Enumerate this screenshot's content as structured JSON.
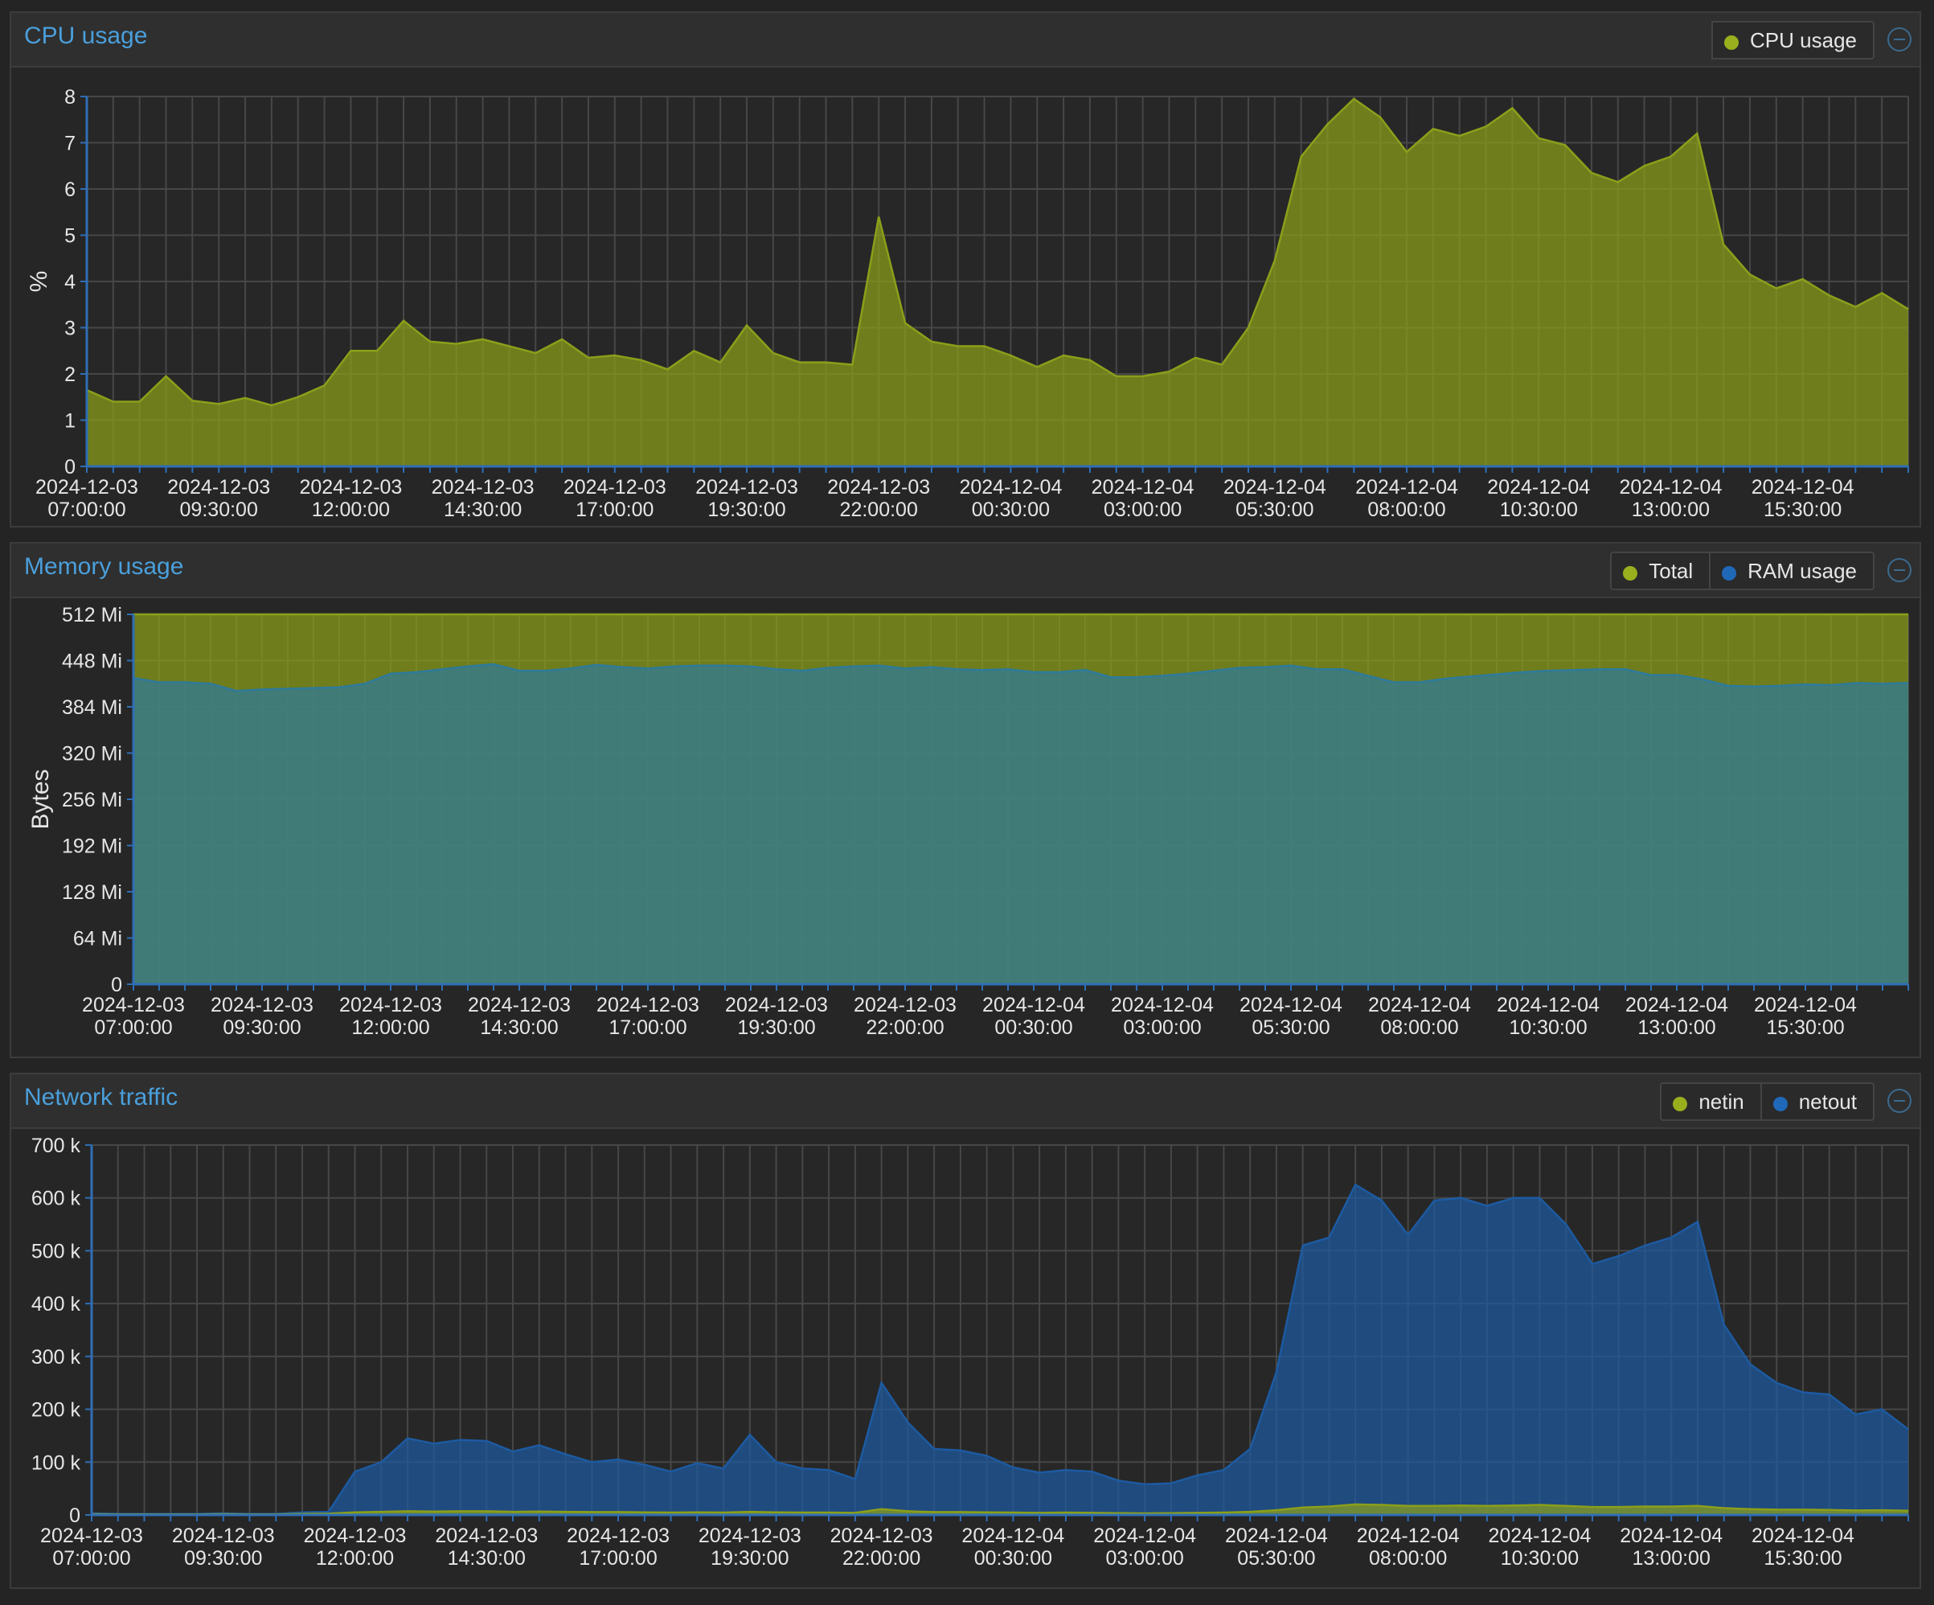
{
  "colors": {
    "green": "#8c9f1a",
    "blue": "#1d5aa1",
    "grid": "#474747",
    "axis": "#2f6eb5"
  },
  "panels": [
    {
      "title": "CPU usage",
      "legend": [
        {
          "label": "CPU usage",
          "color": "#9aaf1e"
        }
      ]
    },
    {
      "title": "Memory usage",
      "legend": [
        {
          "label": "Total",
          "color": "#9aaf1e"
        },
        {
          "label": "RAM usage",
          "color": "#2068b8"
        }
      ]
    },
    {
      "title": "Network traffic",
      "legend": [
        {
          "label": "netin",
          "color": "#9aaf1e"
        },
        {
          "label": "netout",
          "color": "#2068b8"
        }
      ]
    }
  ],
  "chart_data": [
    {
      "type": "area",
      "title": "CPU usage",
      "ylabel": "%",
      "xlabel": "",
      "ylim": [
        0,
        8
      ],
      "yticks": [
        "0",
        "1",
        "2",
        "3",
        "4",
        "5",
        "6",
        "7",
        "8"
      ],
      "x_tick_labels": [
        [
          "2024-12-03",
          "07:00:00"
        ],
        [
          "2024-12-03",
          "09:30:00"
        ],
        [
          "2024-12-03",
          "12:00:00"
        ],
        [
          "2024-12-03",
          "14:30:00"
        ],
        [
          "2024-12-03",
          "17:00:00"
        ],
        [
          "2024-12-03",
          "19:30:00"
        ],
        [
          "2024-12-03",
          "22:00:00"
        ],
        [
          "2024-12-04",
          "00:30:00"
        ],
        [
          "2024-12-04",
          "03:00:00"
        ],
        [
          "2024-12-04",
          "05:30:00"
        ],
        [
          "2024-12-04",
          "08:00:00"
        ],
        [
          "2024-12-04",
          "10:30:00"
        ],
        [
          "2024-12-04",
          "13:00:00"
        ],
        [
          "2024-12-04",
          "15:30:00"
        ]
      ],
      "x_start": "2024-12-03 07:00:00",
      "x_interval_minutes": 30,
      "grid": true,
      "legend": "top-right",
      "series": [
        {
          "name": "CPU usage",
          "color": "#8c9f1a",
          "values": [
            1.65,
            1.4,
            1.4,
            1.95,
            1.42,
            1.35,
            1.48,
            1.32,
            1.5,
            1.75,
            2.5,
            2.5,
            3.15,
            2.7,
            2.65,
            2.75,
            2.6,
            2.45,
            2.75,
            2.35,
            2.4,
            2.3,
            2.1,
            2.5,
            2.25,
            3.05,
            2.45,
            2.25,
            2.25,
            2.2,
            5.4,
            3.1,
            2.7,
            2.6,
            2.6,
            2.4,
            2.15,
            2.4,
            2.3,
            1.95,
            1.95,
            2.05,
            2.35,
            2.2,
            3.0,
            4.45,
            6.7,
            7.4,
            7.95,
            7.55,
            6.8,
            7.3,
            7.15,
            7.35,
            7.75,
            7.1,
            6.95,
            6.35,
            6.15,
            6.5,
            6.7,
            7.2,
            4.8,
            4.15,
            3.85,
            4.05,
            3.7,
            3.45,
            3.75,
            3.4
          ]
        }
      ]
    },
    {
      "type": "area",
      "title": "Memory usage",
      "ylabel": "Bytes",
      "xlabel": "",
      "ylim": [
        0,
        512
      ],
      "yticks": [
        "0",
        "64 Mi",
        "128 Mi",
        "192 Mi",
        "256 Mi",
        "320 Mi",
        "384 Mi",
        "448 Mi",
        "512 Mi"
      ],
      "x_tick_labels": [
        [
          "2024-12-03",
          "07:00:00"
        ],
        [
          "2024-12-03",
          "09:30:00"
        ],
        [
          "2024-12-03",
          "12:00:00"
        ],
        [
          "2024-12-03",
          "14:30:00"
        ],
        [
          "2024-12-03",
          "17:00:00"
        ],
        [
          "2024-12-03",
          "19:30:00"
        ],
        [
          "2024-12-03",
          "22:00:00"
        ],
        [
          "2024-12-04",
          "00:30:00"
        ],
        [
          "2024-12-04",
          "03:00:00"
        ],
        [
          "2024-12-04",
          "05:30:00"
        ],
        [
          "2024-12-04",
          "08:00:00"
        ],
        [
          "2024-12-04",
          "10:30:00"
        ],
        [
          "2024-12-04",
          "13:00:00"
        ],
        [
          "2024-12-04",
          "15:30:00"
        ]
      ],
      "x_start": "2024-12-03 07:00:00",
      "x_interval_minutes": 30,
      "grid": true,
      "legend": "top-right",
      "series": [
        {
          "name": "Total",
          "color": "#8c9f1a",
          "values": [
            512,
            512,
            512,
            512,
            512,
            512,
            512,
            512,
            512,
            512,
            512,
            512,
            512,
            512,
            512,
            512,
            512,
            512,
            512,
            512,
            512,
            512,
            512,
            512,
            512,
            512,
            512,
            512,
            512,
            512,
            512,
            512,
            512,
            512,
            512,
            512,
            512,
            512,
            512,
            512,
            512,
            512,
            512,
            512,
            512,
            512,
            512,
            512,
            512,
            512,
            512,
            512,
            512,
            512,
            512,
            512,
            512,
            512,
            512,
            512,
            512,
            512,
            512,
            512,
            512,
            512,
            512,
            512,
            512,
            512
          ]
        },
        {
          "name": "RAM usage",
          "color": "#2e7a9a",
          "values": [
            424,
            418,
            418,
            416,
            406,
            408,
            409,
            410,
            411,
            416,
            430,
            432,
            436,
            440,
            443,
            434,
            434,
            437,
            442,
            439,
            437,
            440,
            441,
            441,
            440,
            436,
            434,
            438,
            440,
            441,
            437,
            439,
            436,
            435,
            436,
            432,
            432,
            435,
            425,
            425,
            427,
            430,
            434,
            438,
            439,
            441,
            436,
            436,
            427,
            418,
            418,
            423,
            426,
            429,
            432,
            434,
            435,
            436,
            436,
            428,
            428,
            422,
            413,
            412,
            413,
            415,
            414,
            417,
            416,
            417
          ]
        }
      ]
    },
    {
      "type": "area",
      "title": "Network traffic",
      "ylabel": "",
      "xlabel": "",
      "ylim": [
        0,
        700000
      ],
      "yticks": [
        "0",
        "100 k",
        "200 k",
        "300 k",
        "400 k",
        "500 k",
        "600 k",
        "700 k"
      ],
      "x_tick_labels": [
        [
          "2024-12-03",
          "07:00:00"
        ],
        [
          "2024-12-03",
          "09:30:00"
        ],
        [
          "2024-12-03",
          "12:00:00"
        ],
        [
          "2024-12-03",
          "14:30:00"
        ],
        [
          "2024-12-03",
          "17:00:00"
        ],
        [
          "2024-12-03",
          "19:30:00"
        ],
        [
          "2024-12-03",
          "22:00:00"
        ],
        [
          "2024-12-04",
          "00:30:00"
        ],
        [
          "2024-12-04",
          "03:00:00"
        ],
        [
          "2024-12-04",
          "05:30:00"
        ],
        [
          "2024-12-04",
          "08:00:00"
        ],
        [
          "2024-12-04",
          "10:30:00"
        ],
        [
          "2024-12-04",
          "13:00:00"
        ],
        [
          "2024-12-04",
          "15:30:00"
        ]
      ],
      "x_start": "2024-12-03 07:00:00",
      "x_interval_minutes": 30,
      "grid": true,
      "legend": "top-right",
      "series": [
        {
          "name": "netout",
          "color": "#1d5aa1",
          "values": [
            3000,
            2000,
            2000,
            2000,
            2000,
            3000,
            2000,
            2000,
            5000,
            6000,
            82000,
            100000,
            145000,
            135000,
            142000,
            140000,
            120000,
            132000,
            115000,
            100000,
            105000,
            95000,
            82000,
            98000,
            88000,
            152000,
            100000,
            88000,
            85000,
            68000,
            250000,
            175000,
            125000,
            122000,
            112000,
            90000,
            80000,
            85000,
            82000,
            65000,
            58000,
            60000,
            75000,
            85000,
            125000,
            270000,
            510000,
            525000,
            625000,
            595000,
            530000,
            595000,
            600000,
            585000,
            600000,
            600000,
            550000,
            475000,
            490000,
            510000,
            525000,
            555000,
            360000,
            285000,
            250000,
            232000,
            228000,
            190000,
            200000,
            162000
          ]
        },
        {
          "name": "netin",
          "color": "#8c9f1a",
          "values": [
            1500,
            1000,
            1000,
            1000,
            1000,
            1500,
            1000,
            1000,
            2000,
            2500,
            5000,
            6000,
            7000,
            6500,
            7000,
            7000,
            6000,
            6500,
            6000,
            5500,
            5500,
            5000,
            4500,
            5000,
            4500,
            6000,
            5000,
            4500,
            4500,
            4000,
            11000,
            7000,
            5500,
            5500,
            5000,
            4500,
            4000,
            4500,
            4000,
            3500,
            3000,
            3500,
            4000,
            4500,
            6000,
            9000,
            14000,
            16000,
            20000,
            19000,
            17000,
            17000,
            18000,
            17000,
            18000,
            19000,
            17000,
            15000,
            15000,
            16000,
            16000,
            17000,
            13000,
            11000,
            10000,
            10000,
            9500,
            8500,
            9000,
            8000
          ]
        }
      ]
    }
  ]
}
